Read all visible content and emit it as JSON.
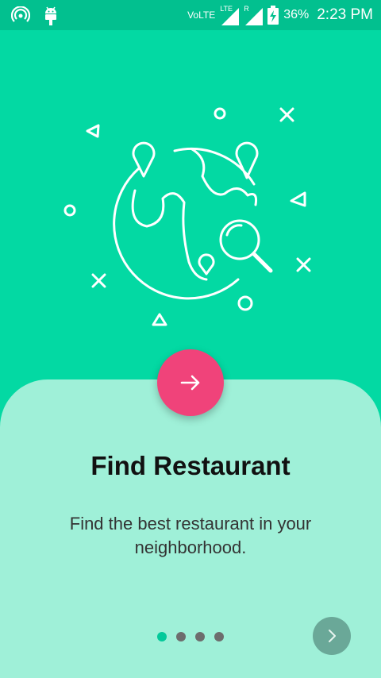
{
  "status_bar": {
    "volte_label": "VoLTE",
    "lte_label": "LTE",
    "roaming_label": "R",
    "battery_percent": "36%",
    "time": "2:23 PM"
  },
  "onboarding": {
    "title": "Find Restaurant",
    "description": "Find the best restaurant in your neighborhood.",
    "page_indicator": {
      "total_pages": 4,
      "current_page": 1
    }
  },
  "colors": {
    "background": "#03d9a3",
    "status_bar": "#02c08f",
    "card": "#9ff0d8",
    "accent": "#f0437a",
    "active_dot": "#03c99a",
    "inactive_dot": "#6d6d6d",
    "next_button": "#6aa898"
  },
  "icons": {
    "fab": "arrow-right-icon",
    "next": "chevron-right-icon",
    "illustration": "globe-search-icon"
  }
}
